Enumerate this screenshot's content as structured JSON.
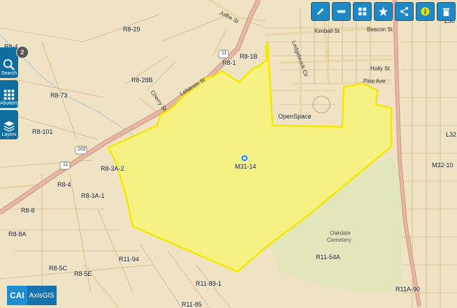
{
  "toolbar": {
    "buttons": [
      {
        "name": "draw",
        "icon": "pencil-icon"
      },
      {
        "name": "measure",
        "icon": "ruler-icon"
      },
      {
        "name": "basemap",
        "icon": "grid-icon"
      },
      {
        "name": "favorites",
        "icon": "star-icon"
      },
      {
        "name": "share",
        "icon": "share-icon"
      },
      {
        "name": "info",
        "icon": "info-icon"
      },
      {
        "name": "clear",
        "icon": "trash-icon"
      }
    ]
  },
  "sidebar": {
    "search_label": "Search",
    "abutters_label": "Abutters",
    "layers_label": "Layers",
    "selection_count": "2"
  },
  "selected_parcel": "M31-14",
  "parcel_labels": {
    "r8_29": "R8-29",
    "r8_4_top": "R8-4",
    "r8_1b": "R8-1B",
    "r8_1": "R8-1",
    "r8_28b": "R8-28B",
    "r8_73": "R8-73",
    "r8_101": "R8-101",
    "r8_3a_2": "R8-3A-2",
    "r8_4": "R8-4",
    "r8_3a_1": "R8-3A-1",
    "r8_8": "R8-8",
    "r8_8a": "R8-8A",
    "r8_5c": "R8-5C",
    "r8_5e": "R8-5E",
    "r11_94": "R11-94",
    "r11_89_1": "R11-89-1",
    "r11_85": "R11-85",
    "r11_54a": "R11-54A",
    "r11a_90": "R11A-90",
    "m32_10": "M32-10",
    "l32": "L32",
    "l30": "L30",
    "open_space": "OpenSpace"
  },
  "street_labels": {
    "joffre": "Joffre St",
    "kimball": "Kimball St",
    "beacon": "Beacon St",
    "lebanon": "Lebanon St",
    "ledgebrook": "Ledgebrook Cir",
    "holly": "Holly St",
    "pine": "Pine Ave",
    "cherry": "Cherry St",
    "route_202": "202",
    "route_11a": "11",
    "route_11b": "11"
  },
  "place_labels": {
    "cemetery_name": "Oakdale",
    "cemetery_type": "Cemetery"
  },
  "logo": {
    "brand": "CAI",
    "product": "AxisGIS"
  },
  "colors": {
    "selection_fill": "#f6f27a",
    "selection_outline": "#f5e800",
    "toolbar_bg": "#1f88c6",
    "sidebar_bg": "#0f6e9f",
    "main_road": "#d9a08a",
    "park": "#dfe7b9"
  }
}
